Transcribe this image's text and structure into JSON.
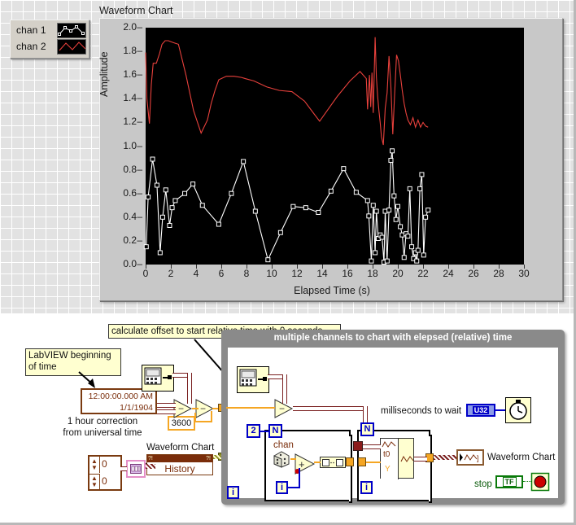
{
  "front_panel": {
    "chart_title": "Waveform Chart",
    "legend": {
      "rows": [
        {
          "label": "chan 1",
          "style": "white-line-square-markers",
          "color": "#ffffff"
        },
        {
          "label": "chan 2",
          "style": "red-line",
          "color": "#e8413c"
        }
      ]
    }
  },
  "chart_data": {
    "type": "line",
    "title": "Waveform Chart",
    "xlabel": "Elapsed Time (s)",
    "ylabel": "Amplitude",
    "xlim": [
      0,
      30
    ],
    "ylim": [
      0,
      2.0
    ],
    "xticks": [
      0,
      2,
      4,
      6,
      8,
      10,
      12,
      14,
      16,
      18,
      20,
      22,
      24,
      26,
      28,
      30
    ],
    "yticks": [
      "0.0",
      "0.2",
      "0.4",
      "0.6",
      "0.8",
      "1.0",
      "1.2",
      "1.4",
      "1.6",
      "1.8",
      "2.0"
    ],
    "grid": false,
    "legend_position": "outside-left",
    "plot_background": "#000000",
    "series": [
      {
        "name": "chan 1",
        "color": "#ffffff",
        "marker": "square",
        "x": [
          0.05,
          0.2,
          0.55,
          0.9,
          1.15,
          1.35,
          1.6,
          1.9,
          2.1,
          2.35,
          3.1,
          3.75,
          4.5,
          5.8,
          6.8,
          7.75,
          8.7,
          9.7,
          10.7,
          11.7,
          12.7,
          13.7,
          14.7,
          15.7,
          16.7,
          17.6,
          17.7,
          17.9,
          18.05,
          18.2,
          18.3,
          18.45,
          18.6,
          18.75,
          18.9,
          19.0,
          19.15,
          19.3,
          19.45,
          19.55,
          19.7,
          19.85,
          20.0,
          20.2,
          20.35,
          20.5,
          20.65,
          20.8,
          20.95,
          21.1,
          21.25,
          21.4,
          21.5,
          21.6,
          21.75,
          21.9,
          22.05,
          22.2,
          22.4
        ],
        "y": [
          0.15,
          0.57,
          0.89,
          0.67,
          0.1,
          0.4,
          0.63,
          0.33,
          0.48,
          0.54,
          0.6,
          0.68,
          0.5,
          0.34,
          0.6,
          0.87,
          0.45,
          0.04,
          0.27,
          0.49,
          0.48,
          0.44,
          0.62,
          0.81,
          0.61,
          0.54,
          0.41,
          0.03,
          0.5,
          0.1,
          0.45,
          0.22,
          0.25,
          0.23,
          0.02,
          0.45,
          0.03,
          0.46,
          0.88,
          0.96,
          0.58,
          0.38,
          0.49,
          0.32,
          0.25,
          0.06,
          0.26,
          0.24,
          0.64,
          0.15,
          0.05,
          0.1,
          0.03,
          0.12,
          0.64,
          0.76,
          0.08,
          0.4,
          0.46
        ]
      },
      {
        "name": "chan 2",
        "color": "#e8413c",
        "marker": "none",
        "x": [
          0.0,
          0.1,
          0.3,
          0.45,
          0.6,
          0.85,
          1.1,
          1.3,
          1.55,
          1.8,
          2.05,
          2.3,
          2.6,
          3.2,
          3.8,
          4.4,
          4.9,
          5.2,
          5.5,
          5.8,
          6.4,
          7.0,
          7.6,
          7.9,
          8.6,
          9.6,
          10.6,
          11.6,
          12.6,
          13.3,
          13.8,
          14.4,
          15.2,
          16.2,
          17.0,
          17.5,
          17.6,
          17.75,
          17.85,
          17.95,
          18.05,
          18.2,
          18.3,
          18.4,
          18.5,
          18.6,
          18.7,
          18.85,
          19.0,
          19.15,
          19.3,
          19.45,
          19.6,
          19.75,
          19.9,
          20.05,
          20.2,
          20.35,
          20.5,
          20.65,
          20.8,
          21.0,
          21.2,
          21.4,
          21.6,
          21.8,
          22.0,
          22.2,
          22.4
        ],
        "y": [
          1.79,
          1.4,
          1.19,
          1.52,
          1.7,
          1.7,
          1.78,
          1.86,
          1.89,
          1.89,
          1.88,
          1.87,
          1.86,
          1.6,
          1.3,
          1.11,
          1.22,
          1.36,
          1.47,
          1.56,
          1.59,
          1.59,
          1.58,
          1.57,
          1.55,
          1.5,
          1.47,
          1.46,
          1.38,
          1.28,
          1.21,
          1.3,
          1.42,
          1.55,
          1.63,
          1.57,
          1.31,
          1.6,
          1.33,
          1.62,
          1.28,
          1.92,
          1.58,
          1.42,
          1.3,
          1.2,
          1.08,
          1.01,
          1.32,
          1.45,
          1.76,
          1.5,
          1.1,
          1.45,
          1.77,
          1.72,
          1.6,
          1.47,
          1.36,
          1.28,
          1.22,
          1.18,
          1.24,
          1.16,
          1.22,
          1.16,
          1.2,
          1.17,
          1.16
        ]
      }
    ]
  },
  "block_diagram": {
    "comment_offset": "calculate offset to start relative time with 0 seconds",
    "comment_labview_epoch": "LabVIEW beginning\nof time",
    "timestamp_constant": "12:00:00.000 AM\n1/1/1904",
    "hour_correction_label": "1 hour correction\nfrom universal time",
    "hour_correction_value": "3600",
    "history_label": "History",
    "history_chart_label": "Waveform Chart",
    "history_zero_top": "0",
    "history_zero_bottom": "0",
    "subframe_title": "multiple channels to chart with elepsed (relative) time",
    "chan_label": "chan",
    "channel_count": "2",
    "loop_count_terminal": "N",
    "loop_index_terminal": "i",
    "ms_wait_label": "milliseconds to wait",
    "ms_wait_type": "U32",
    "bundle_t0": "t0",
    "bundle_y": "Y",
    "chart_indicator_label": "Waveform Chart",
    "stop_label": "stop",
    "stop_type": "TF"
  }
}
